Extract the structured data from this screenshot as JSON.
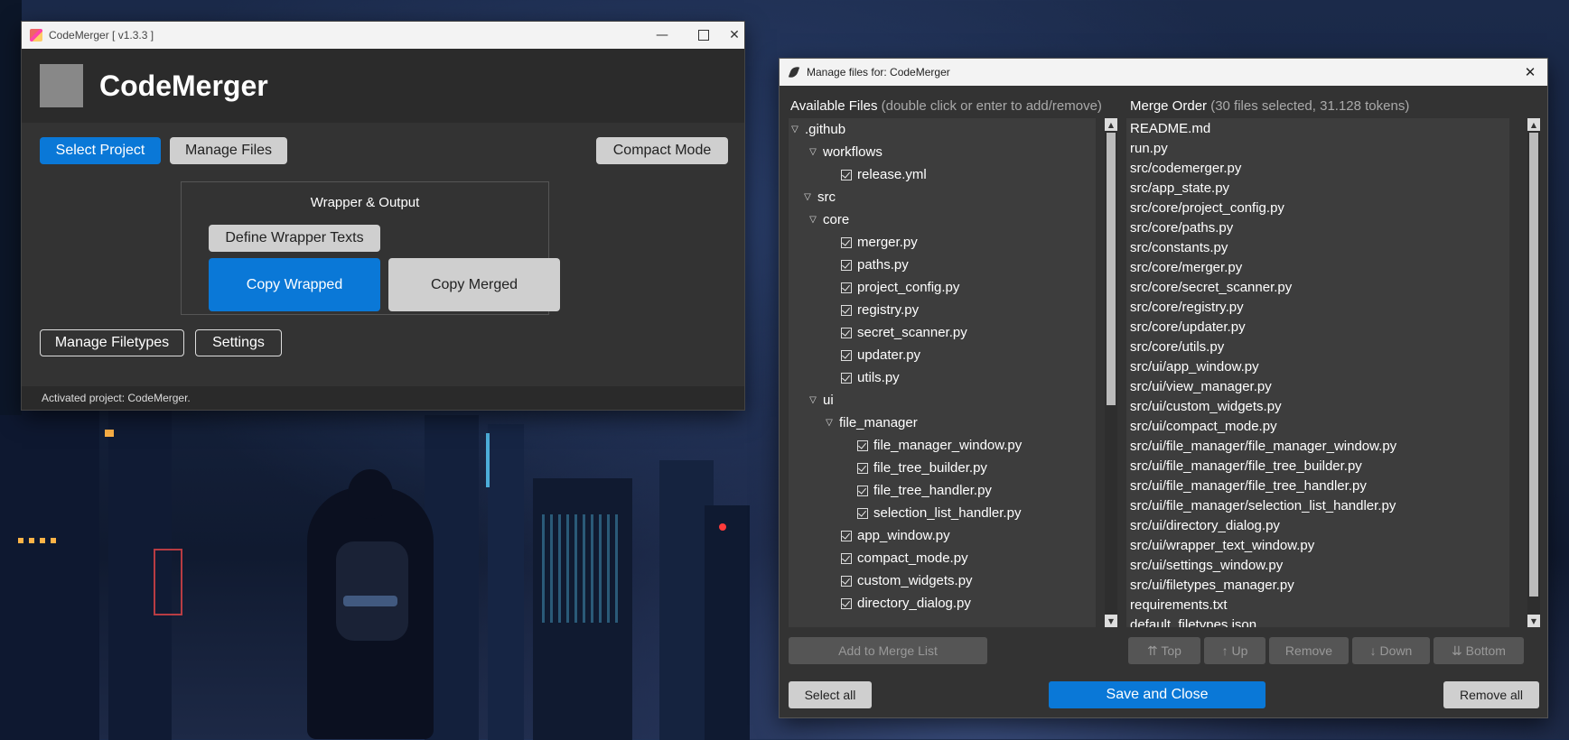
{
  "main_window": {
    "title": "CodeMerger [ v1.3.3 ]",
    "app_name": "CodeMerger",
    "buttons": {
      "select_project": "Select Project",
      "manage_files": "Manage Files",
      "compact_mode": "Compact Mode",
      "define_wrapper": "Define Wrapper Texts",
      "copy_wrapped": "Copy Wrapped",
      "copy_merged": "Copy Merged",
      "manage_filetypes": "Manage Filetypes",
      "settings": "Settings"
    },
    "group_title": "Wrapper & Output",
    "status": "Activated project: CodeMerger."
  },
  "dialog": {
    "title": "Manage files for: CodeMerger",
    "available_label": "Available Files",
    "available_hint": "(double click or enter to add/remove)",
    "merge_label": "Merge Order",
    "merge_hint": "(30 files selected, 31.128 tokens)",
    "tree": [
      {
        "label": ".github",
        "type": "folder"
      },
      {
        "label": "workflows",
        "type": "folder"
      },
      {
        "label": "release.yml",
        "type": "file"
      },
      {
        "label": "src",
        "type": "folder"
      },
      {
        "label": "core",
        "type": "folder"
      },
      {
        "label": "merger.py",
        "type": "file"
      },
      {
        "label": "paths.py",
        "type": "file"
      },
      {
        "label": "project_config.py",
        "type": "file"
      },
      {
        "label": "registry.py",
        "type": "file"
      },
      {
        "label": "secret_scanner.py",
        "type": "file"
      },
      {
        "label": "updater.py",
        "type": "file"
      },
      {
        "label": "utils.py",
        "type": "file"
      },
      {
        "label": "ui",
        "type": "folder"
      },
      {
        "label": "file_manager",
        "type": "folder"
      },
      {
        "label": "file_manager_window.py",
        "type": "file"
      },
      {
        "label": "file_tree_builder.py",
        "type": "file"
      },
      {
        "label": "file_tree_handler.py",
        "type": "file"
      },
      {
        "label": "selection_list_handler.py",
        "type": "file"
      },
      {
        "label": "app_window.py",
        "type": "file"
      },
      {
        "label": "compact_mode.py",
        "type": "file"
      },
      {
        "label": "custom_widgets.py",
        "type": "file"
      },
      {
        "label": "directory_dialog.py",
        "type": "file"
      }
    ],
    "merge_order": [
      "README.md",
      "run.py",
      "src/codemerger.py",
      "src/app_state.py",
      "src/core/project_config.py",
      "src/core/paths.py",
      "src/constants.py",
      "src/core/merger.py",
      "src/core/secret_scanner.py",
      "src/core/registry.py",
      "src/core/updater.py",
      "src/core/utils.py",
      "src/ui/app_window.py",
      "src/ui/view_manager.py",
      "src/ui/custom_widgets.py",
      "src/ui/compact_mode.py",
      "src/ui/file_manager/file_manager_window.py",
      "src/ui/file_manager/file_tree_builder.py",
      "src/ui/file_manager/file_tree_handler.py",
      "src/ui/file_manager/selection_list_handler.py",
      "src/ui/directory_dialog.py",
      "src/ui/wrapper_text_window.py",
      "src/ui/settings_window.py",
      "src/ui/filetypes_manager.py",
      "requirements.txt",
      "default_filetypes.json"
    ],
    "buttons": {
      "add_to_merge": "Add to Merge List",
      "top": "⇈ Top",
      "up": "↑ Up",
      "remove": "Remove",
      "down": "↓ Down",
      "bottom": "⇊ Bottom",
      "select_all": "Select all",
      "save_close": "Save and Close",
      "remove_all": "Remove all"
    }
  },
  "colors": {
    "accent": "#0a78d7",
    "window_bg": "#333333",
    "header_bg": "#2b2b2b"
  }
}
